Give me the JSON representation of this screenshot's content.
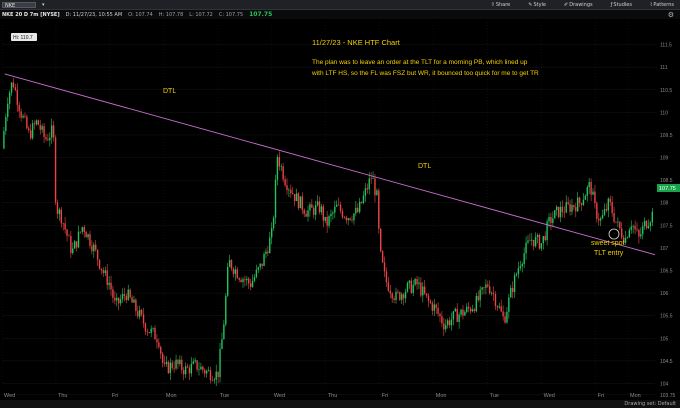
{
  "toolbar": {
    "symbol": "NKE",
    "share_label": "Share",
    "style_label": "Style",
    "drawings_label": "Drawings",
    "studies_label": "Studies",
    "patterns_label": "Patterns"
  },
  "infobar": {
    "symbol_label": "NKE 20 D 7m [NYSE]",
    "last_price": "107.75",
    "date_time": "D: 11/27/23, 10:55 AM",
    "open": "O: 107.74",
    "high": "H: 107.78",
    "low": "L: 107.72",
    "close": "C: 107.75"
  },
  "annotations": {
    "title": "11/27/23 - NKE HTF Chart",
    "note_line1": "The plan was to leave an order at the TLT for a morning PB, which lined up",
    "note_line2": "with LTF HS, so the FL was FSZ but WR, it bounced too quick for me to get TR",
    "dtl_label_1": "DTL",
    "dtl_label_2": "DTL",
    "entry_label_1": "sweet spot",
    "entry_label_2": "TLT entry",
    "high_marker": "Hi: 110.7"
  },
  "status": {
    "drawing_set": "Drawing set: Default"
  },
  "chart_data": {
    "type": "candlestick",
    "ylim": [
      103.9,
      112.0
    ],
    "y_ticks": [
      "111.5",
      "111",
      "110.5",
      "110",
      "109.5",
      "109",
      "108.5",
      "108",
      "107.5",
      "107",
      "106.5",
      "106",
      "105.5",
      "105",
      "104.5",
      "104",
      "103.75"
    ],
    "x_tick_labels": [
      "Wed",
      "Thu",
      "Fri",
      "Mon",
      "Tue",
      "Wed",
      "Thu",
      "Fri",
      "Mon",
      "Tue",
      "Wed",
      "Fri",
      "Mon"
    ],
    "x_tick_positions": [
      0.0,
      1.0,
      2.0,
      3.0,
      4.0,
      5.0,
      6.0,
      7.0,
      8.0,
      9.0,
      10.0,
      11.0,
      11.6
    ],
    "x_range": [
      0,
      12.1
    ],
    "last_price_label": "107.75",
    "up_color": "#22c55e",
    "down_color": "#ef4444",
    "trendline_color": "#c86ed0",
    "trendline": {
      "start": [
        0.05,
        110.85
      ],
      "end": [
        12.1,
        106.85
      ]
    },
    "price_path": [
      [
        0.0,
        109.2
      ],
      [
        0.1,
        110.3
      ],
      [
        0.2,
        110.7
      ],
      [
        0.35,
        110.0
      ],
      [
        0.5,
        109.5
      ],
      [
        0.65,
        109.8
      ],
      [
        0.8,
        109.4
      ],
      [
        0.95,
        109.6
      ],
      [
        1.0,
        107.9
      ],
      [
        1.1,
        107.7
      ],
      [
        1.3,
        106.9
      ],
      [
        1.5,
        107.5
      ],
      [
        1.7,
        107.0
      ],
      [
        1.9,
        106.4
      ],
      [
        2.0,
        106.2
      ],
      [
        2.1,
        105.7
      ],
      [
        2.3,
        106.0
      ],
      [
        2.5,
        105.6
      ],
      [
        2.7,
        105.2
      ],
      [
        2.9,
        105.0
      ],
      [
        3.0,
        104.3
      ],
      [
        3.2,
        104.45
      ],
      [
        3.4,
        104.3
      ],
      [
        3.6,
        104.4
      ],
      [
        3.8,
        104.25
      ],
      [
        4.0,
        104.2
      ],
      [
        4.1,
        105.2
      ],
      [
        4.2,
        106.7
      ],
      [
        4.4,
        106.4
      ],
      [
        4.6,
        106.2
      ],
      [
        4.8,
        106.6
      ],
      [
        5.0,
        107.3
      ],
      [
        5.05,
        108.0
      ],
      [
        5.1,
        109.05
      ],
      [
        5.25,
        108.5
      ],
      [
        5.45,
        108.1
      ],
      [
        5.65,
        107.8
      ],
      [
        5.9,
        107.9
      ],
      [
        6.0,
        107.5
      ],
      [
        6.2,
        107.9
      ],
      [
        6.4,
        107.7
      ],
      [
        6.6,
        107.8
      ],
      [
        6.85,
        108.6
      ],
      [
        6.95,
        108.1
      ],
      [
        7.0,
        106.9
      ],
      [
        7.1,
        106.3
      ],
      [
        7.3,
        105.9
      ],
      [
        7.5,
        106.1
      ],
      [
        7.7,
        106.2
      ],
      [
        7.9,
        105.8
      ],
      [
        8.0,
        105.7
      ],
      [
        8.2,
        105.3
      ],
      [
        8.4,
        105.5
      ],
      [
        8.6,
        105.6
      ],
      [
        8.8,
        105.8
      ],
      [
        9.0,
        106.2
      ],
      [
        9.1,
        106.0
      ],
      [
        9.3,
        105.4
      ],
      [
        9.45,
        106.1
      ],
      [
        9.6,
        106.7
      ],
      [
        9.8,
        107.2
      ],
      [
        10.0,
        107.1
      ],
      [
        10.15,
        107.6
      ],
      [
        10.3,
        107.8
      ],
      [
        10.5,
        107.9
      ],
      [
        10.7,
        108.0
      ],
      [
        10.9,
        108.4
      ],
      [
        11.0,
        107.8
      ],
      [
        11.1,
        107.6
      ],
      [
        11.25,
        108.0
      ],
      [
        11.4,
        107.5
      ],
      [
        11.55,
        107.2
      ],
      [
        11.65,
        107.6
      ],
      [
        11.8,
        107.2
      ],
      [
        11.9,
        107.5
      ],
      [
        12.05,
        107.75
      ]
    ]
  }
}
